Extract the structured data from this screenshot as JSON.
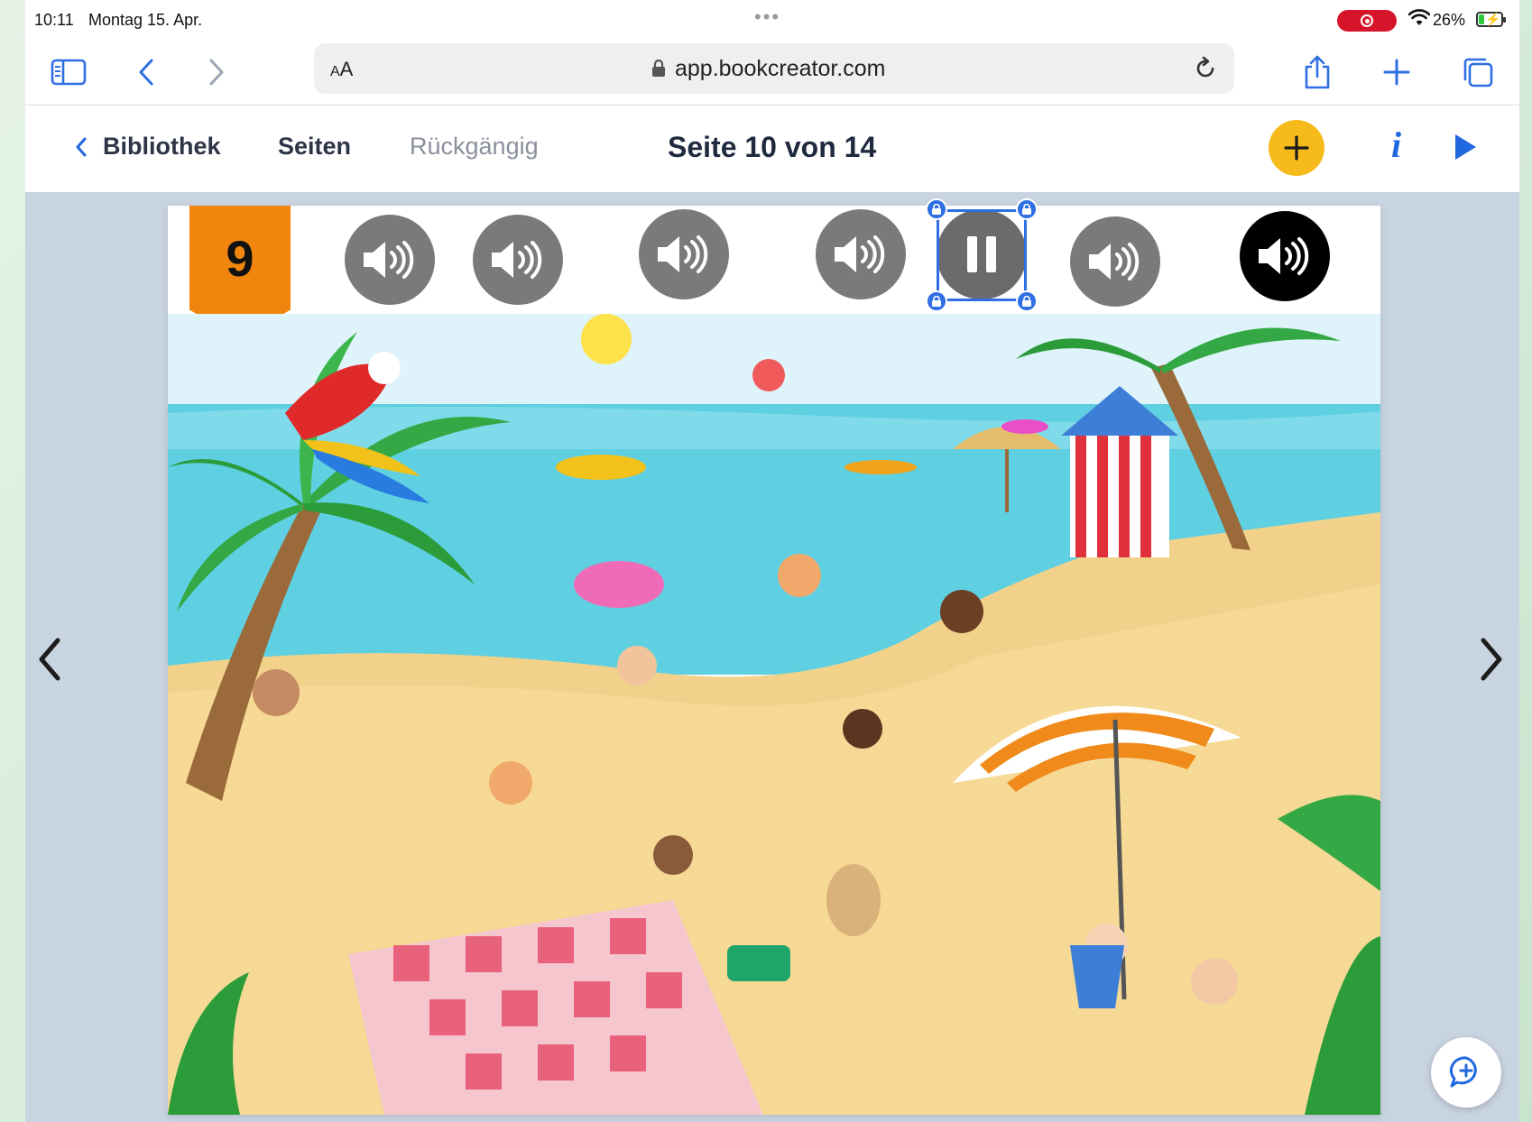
{
  "status_bar": {
    "time": "10:11",
    "date": "Montag 15. Apr.",
    "battery_percent": "26%",
    "battery_level": 0.26,
    "recording_color": "#d7152a"
  },
  "browser": {
    "aa_small": "A",
    "aa_large": "A",
    "url": "app.bookcreator.com",
    "icons": [
      "sidebar-icon",
      "back-icon",
      "forward-icon",
      "share-icon",
      "plus-icon",
      "tabs-icon",
      "lock-icon",
      "reload-icon"
    ]
  },
  "toolbar": {
    "back_label": "Bibliothek",
    "pages_label": "Seiten",
    "undo_label": "Rückgängig",
    "title": "Seite 10 von 14",
    "add_color": "#f6bb1b",
    "accent_color": "#2068e0"
  },
  "page": {
    "badge_number": "9",
    "badge_color": "#f0860d",
    "audio_buttons": [
      {
        "state": "inactive"
      },
      {
        "state": "inactive"
      },
      {
        "state": "inactive"
      },
      {
        "state": "inactive"
      },
      {
        "state": "playing-selected"
      },
      {
        "state": "inactive"
      },
      {
        "state": "active"
      }
    ],
    "selection_color": "#2f6fe4"
  }
}
